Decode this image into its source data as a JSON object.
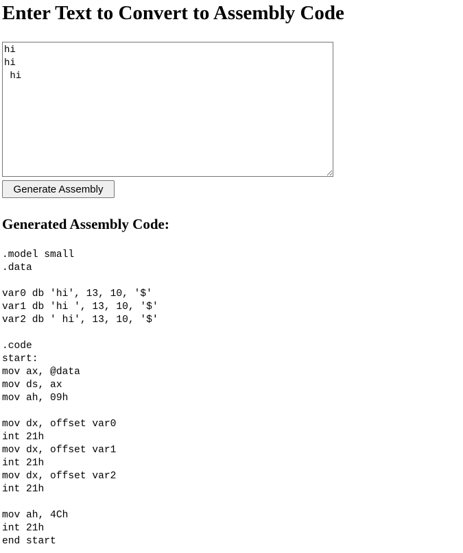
{
  "page": {
    "title": "Enter Text to Convert to Assembly Code"
  },
  "input": {
    "value": "hi\nhi \n hi",
    "placeholder": ""
  },
  "actions": {
    "generate_label": "Generate Assembly"
  },
  "output": {
    "heading": "Generated Assembly Code:",
    "code": ".model small\n.data\n\nvar0 db 'hi', 13, 10, '$'\nvar1 db 'hi ', 13, 10, '$'\nvar2 db ' hi', 13, 10, '$'\n\n.code\nstart:\nmov ax, @data\nmov ds, ax\nmov ah, 09h\n\nmov dx, offset var0\nint 21h\nmov dx, offset var1\nint 21h\nmov dx, offset var2\nint 21h\n\nmov ah, 4Ch\nint 21h\nend start"
  }
}
